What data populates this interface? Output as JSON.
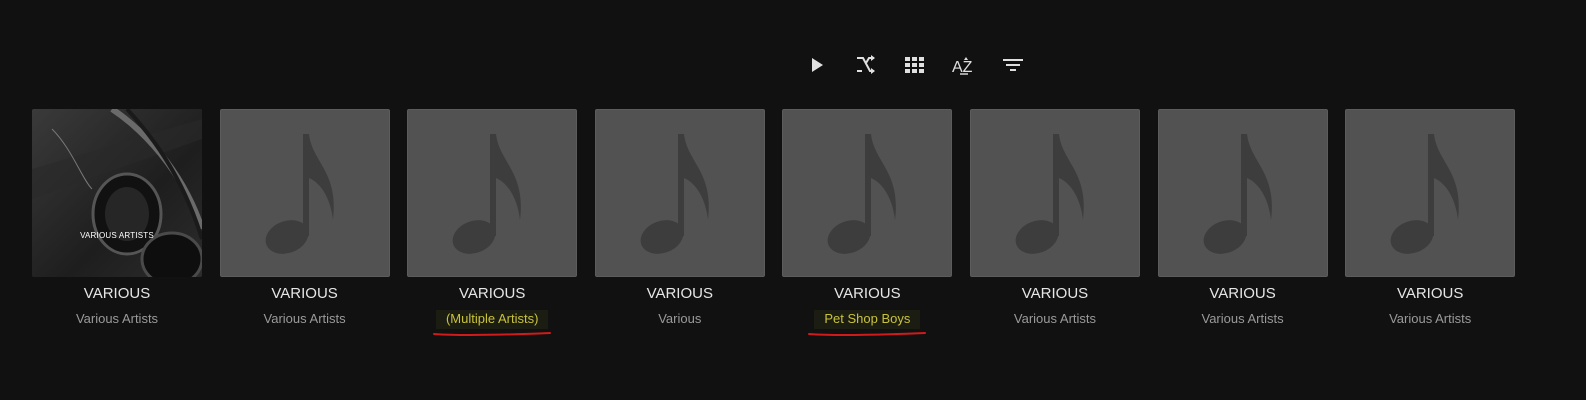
{
  "toolbar": {
    "icons": [
      "play-icon",
      "shuffle-icon",
      "grid-view-icon",
      "sort-az-icon",
      "filter-icon"
    ],
    "sort_label": "AZ"
  },
  "albums": [
    {
      "title": "VARIOUS",
      "artist": "Various Artists",
      "art": "photo",
      "art_caption": "VARIOUS ARTISTS",
      "highlight": false
    },
    {
      "title": "VARIOUS",
      "artist": "Various Artists",
      "art": "placeholder",
      "highlight": false
    },
    {
      "title": "VARIOUS",
      "artist": "(Multiple Artists)",
      "art": "placeholder",
      "highlight": true
    },
    {
      "title": "VARIOUS",
      "artist": "Various",
      "art": "placeholder",
      "highlight": false
    },
    {
      "title": "VARIOUS",
      "artist": "Pet Shop Boys",
      "art": "placeholder",
      "highlight": true
    },
    {
      "title": "VARIOUS",
      "artist": "Various Artists",
      "art": "placeholder",
      "highlight": false
    },
    {
      "title": "VARIOUS",
      "artist": "Various Artists",
      "art": "placeholder",
      "highlight": false
    },
    {
      "title": "VARIOUS",
      "artist": "Various Artists",
      "art": "placeholder",
      "highlight": false
    }
  ],
  "colors": {
    "background": "#111111",
    "placeholder": "#525252",
    "highlight_text": "#c9c23b",
    "annotation_underline": "#d11a1a"
  }
}
